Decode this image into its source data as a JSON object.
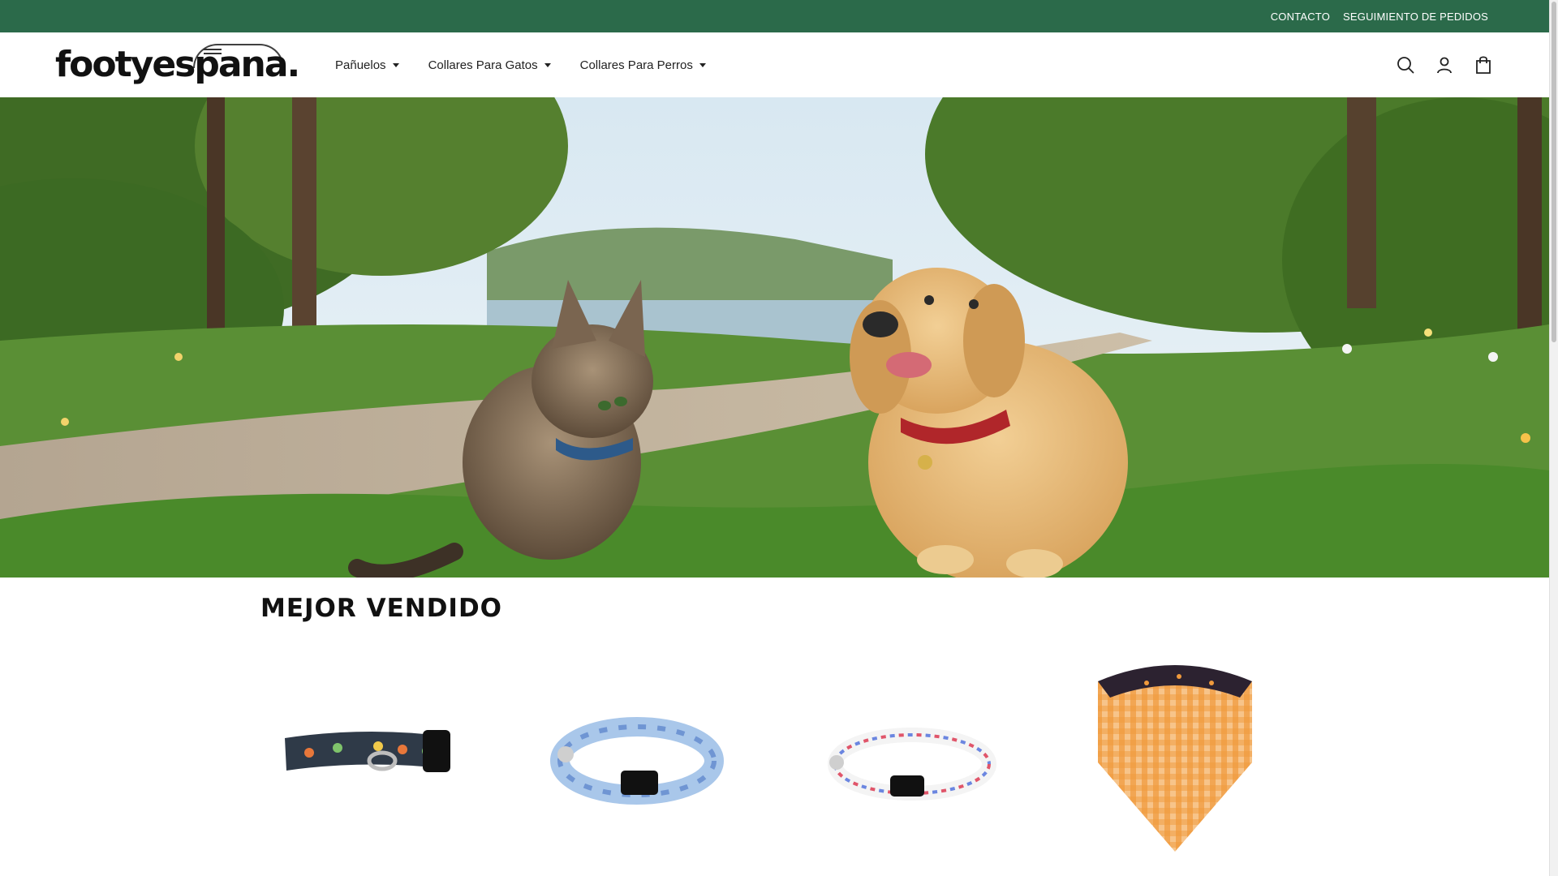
{
  "topbar": {
    "links": [
      "CONTACTO",
      "SEGUIMIENTO DE PEDIDOS"
    ]
  },
  "header": {
    "logo_text": "footyespana.",
    "nav": [
      {
        "label": "Pañuelos"
      },
      {
        "label": "Collares Para Gatos"
      },
      {
        "label": "Collares Para Perros"
      }
    ],
    "icons": [
      "search-icon",
      "account-icon",
      "cart-icon"
    ]
  },
  "hero": {
    "image": "cat-and-puppy-with-collars-on-grass-path"
  },
  "bestsellers": {
    "title": "MEJOR VENDIDO",
    "products": [
      {
        "image": "dark-dinosaur-dog-collar"
      },
      {
        "image": "blue-floral-cat-collar"
      },
      {
        "image": "rainbow-dots-cat-collar"
      },
      {
        "image": "orange-gingham-halloween-bandana"
      }
    ]
  },
  "colors": {
    "topbar_bg": "#2b6a4a",
    "text": "#1a1a1a"
  }
}
